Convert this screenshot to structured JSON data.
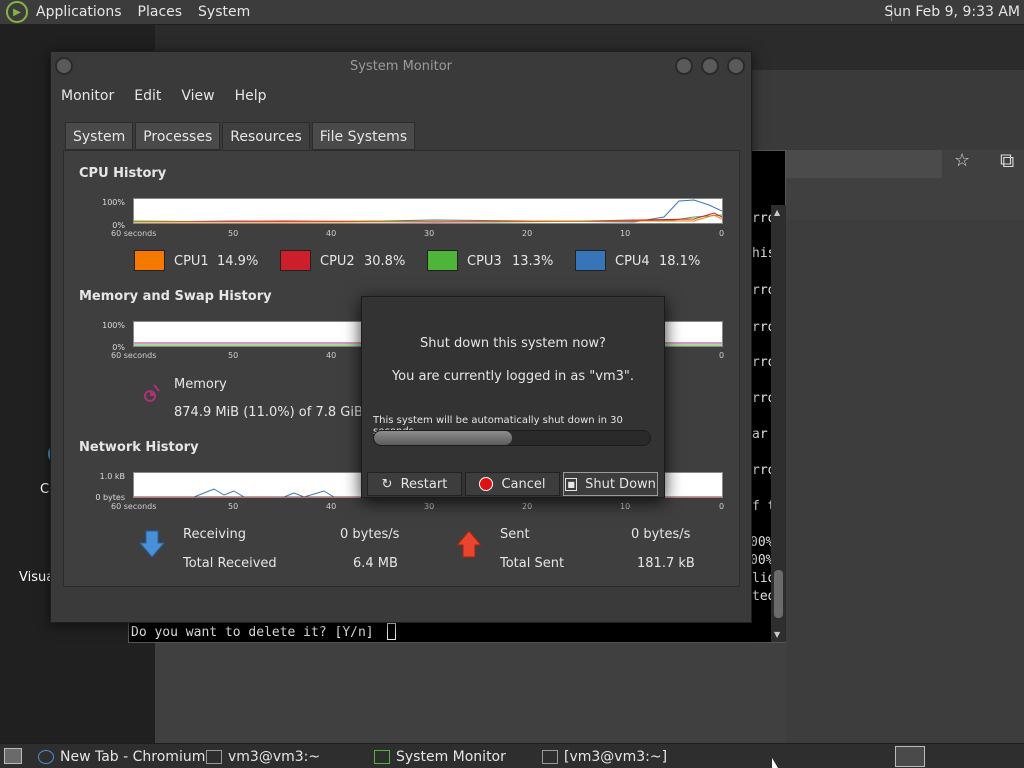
{
  "top_panel": {
    "menu": [
      "Applications",
      "Places",
      "System"
    ],
    "clock": "Sun Feb 9, 9:33 AM"
  },
  "desktop": {
    "icon_labels": [
      "C",
      "Visua"
    ]
  },
  "terminal": {
    "fragments": [
      "rro",
      "his",
      "rro",
      "rro",
      "rro",
      "rro",
      "ar",
      "rro",
      "f t",
      "00%",
      "00%",
      "lid",
      "ted"
    ],
    "prompt": "Do you want to delete it? [Y/n]"
  },
  "system_monitor": {
    "title": "System Monitor",
    "menu": [
      "Monitor",
      "Edit",
      "View",
      "Help"
    ],
    "tabs": [
      "System",
      "Processes",
      "Resources",
      "File Systems"
    ],
    "active_tab": "Resources",
    "ticks": [
      "60 seconds",
      "50",
      "40",
      "30",
      "20",
      "10",
      "0"
    ],
    "cpu": {
      "title": "CPU History",
      "y_top": "100%",
      "y_bottom": "0%",
      "cores": [
        {
          "name": "CPU1",
          "value": "14.9%",
          "color": "#f57900"
        },
        {
          "name": "CPU2",
          "value": "30.8%",
          "color": "#cc1e2b"
        },
        {
          "name": "CPU3",
          "value": "13.3%",
          "color": "#4eb53a"
        },
        {
          "name": "CPU4",
          "value": "18.1%",
          "color": "#3676b8"
        }
      ]
    },
    "memory": {
      "title": "Memory and Swap History",
      "y_top": "100%",
      "y_bottom": "0%",
      "label": "Memory",
      "value": "874.9 MiB (11.0%) of 7.8 GiB"
    },
    "network": {
      "title": "Network History",
      "y_top": "1.0 kB",
      "y_bottom": "0 bytes",
      "receiving_label": "Receiving",
      "receiving_value": "0 bytes/s",
      "total_received_label": "Total Received",
      "total_received_value": "6.4 MB",
      "sent_label": "Sent",
      "sent_value": "0 bytes/s",
      "total_sent_label": "Total Sent",
      "total_sent_value": "181.7 kB"
    }
  },
  "dialog": {
    "question": "Shut down this system now?",
    "logged_in": "You are currently logged in as \"vm3\".",
    "countdown": "This system will be automatically shut down in 30 seconds",
    "progress": 0.5,
    "restart_label": "Restart",
    "cancel_label": "Cancel",
    "shutdown_label": "Shut Down"
  },
  "taskbar": {
    "tasks": [
      "New Tab - Chromium",
      "vm3@vm3:~",
      "System Monitor",
      "[vm3@vm3:~]"
    ]
  }
}
